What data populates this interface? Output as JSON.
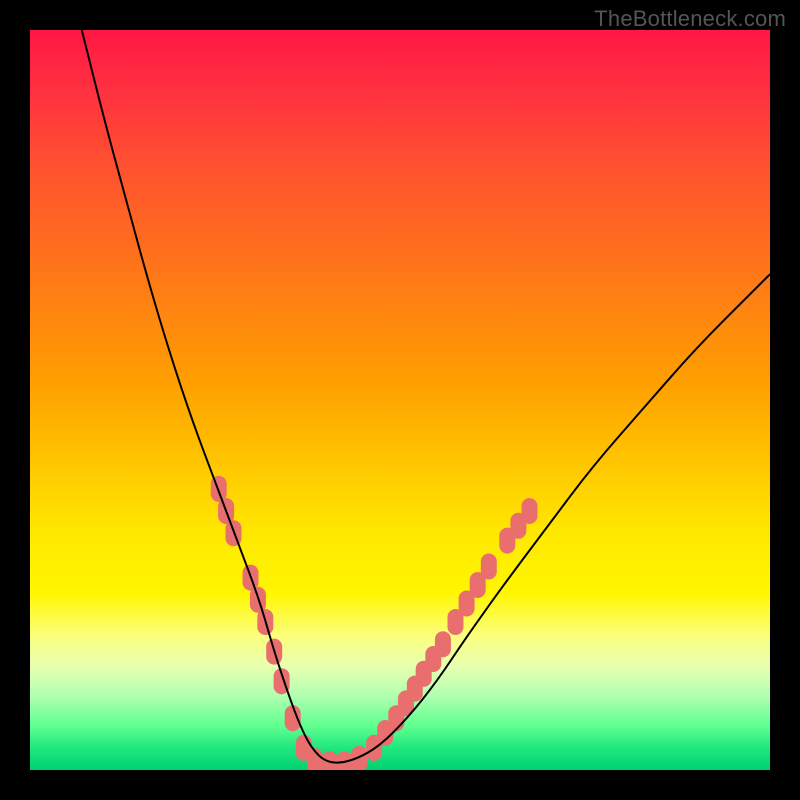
{
  "watermark": "TheBottleneck.com",
  "chart_data": {
    "type": "line",
    "title": "",
    "xlabel": "",
    "ylabel": "",
    "xlim": [
      0,
      100
    ],
    "ylim": [
      0,
      100
    ],
    "legend": false,
    "grid": false,
    "background": "rainbow-gradient-red-to-green-vertical",
    "series": [
      {
        "name": "bottleneck-curve",
        "color": "#000000",
        "x": [
          7,
          10,
          13,
          16,
          19,
          22,
          25,
          28,
          31,
          33,
          35,
          36.5,
          38,
          40,
          43,
          47,
          51,
          55,
          59,
          64,
          70,
          76,
          83,
          90,
          98,
          100
        ],
        "y": [
          100,
          88,
          77,
          66,
          56,
          47,
          39,
          31,
          23,
          16,
          10,
          6,
          3,
          1,
          1,
          3,
          7,
          12,
          18,
          25,
          33,
          41,
          49,
          57,
          65,
          67
        ]
      }
    ],
    "markers": [
      {
        "name": "highlight-dots",
        "shape": "rounded-rect",
        "color": "#e96f6f",
        "points": [
          {
            "x": 25.5,
            "y": 38
          },
          {
            "x": 26.5,
            "y": 35
          },
          {
            "x": 27.5,
            "y": 32
          },
          {
            "x": 29.8,
            "y": 26
          },
          {
            "x": 30.8,
            "y": 23
          },
          {
            "x": 31.8,
            "y": 20
          },
          {
            "x": 33.0,
            "y": 16
          },
          {
            "x": 34.0,
            "y": 12
          },
          {
            "x": 35.5,
            "y": 7
          },
          {
            "x": 37.0,
            "y": 3
          },
          {
            "x": 38.5,
            "y": 1.2
          },
          {
            "x": 40.5,
            "y": 0.8
          },
          {
            "x": 42.5,
            "y": 0.8
          },
          {
            "x": 44.5,
            "y": 1.5
          },
          {
            "x": 46.5,
            "y": 3
          },
          {
            "x": 48.0,
            "y": 5
          },
          {
            "x": 49.5,
            "y": 7
          },
          {
            "x": 50.8,
            "y": 9
          },
          {
            "x": 52.0,
            "y": 11
          },
          {
            "x": 53.2,
            "y": 13
          },
          {
            "x": 54.5,
            "y": 15
          },
          {
            "x": 55.8,
            "y": 17
          },
          {
            "x": 57.5,
            "y": 20
          },
          {
            "x": 59.0,
            "y": 22.5
          },
          {
            "x": 60.5,
            "y": 25
          },
          {
            "x": 62.0,
            "y": 27.5
          },
          {
            "x": 64.5,
            "y": 31
          },
          {
            "x": 66.0,
            "y": 33
          },
          {
            "x": 67.5,
            "y": 35
          }
        ]
      }
    ]
  }
}
